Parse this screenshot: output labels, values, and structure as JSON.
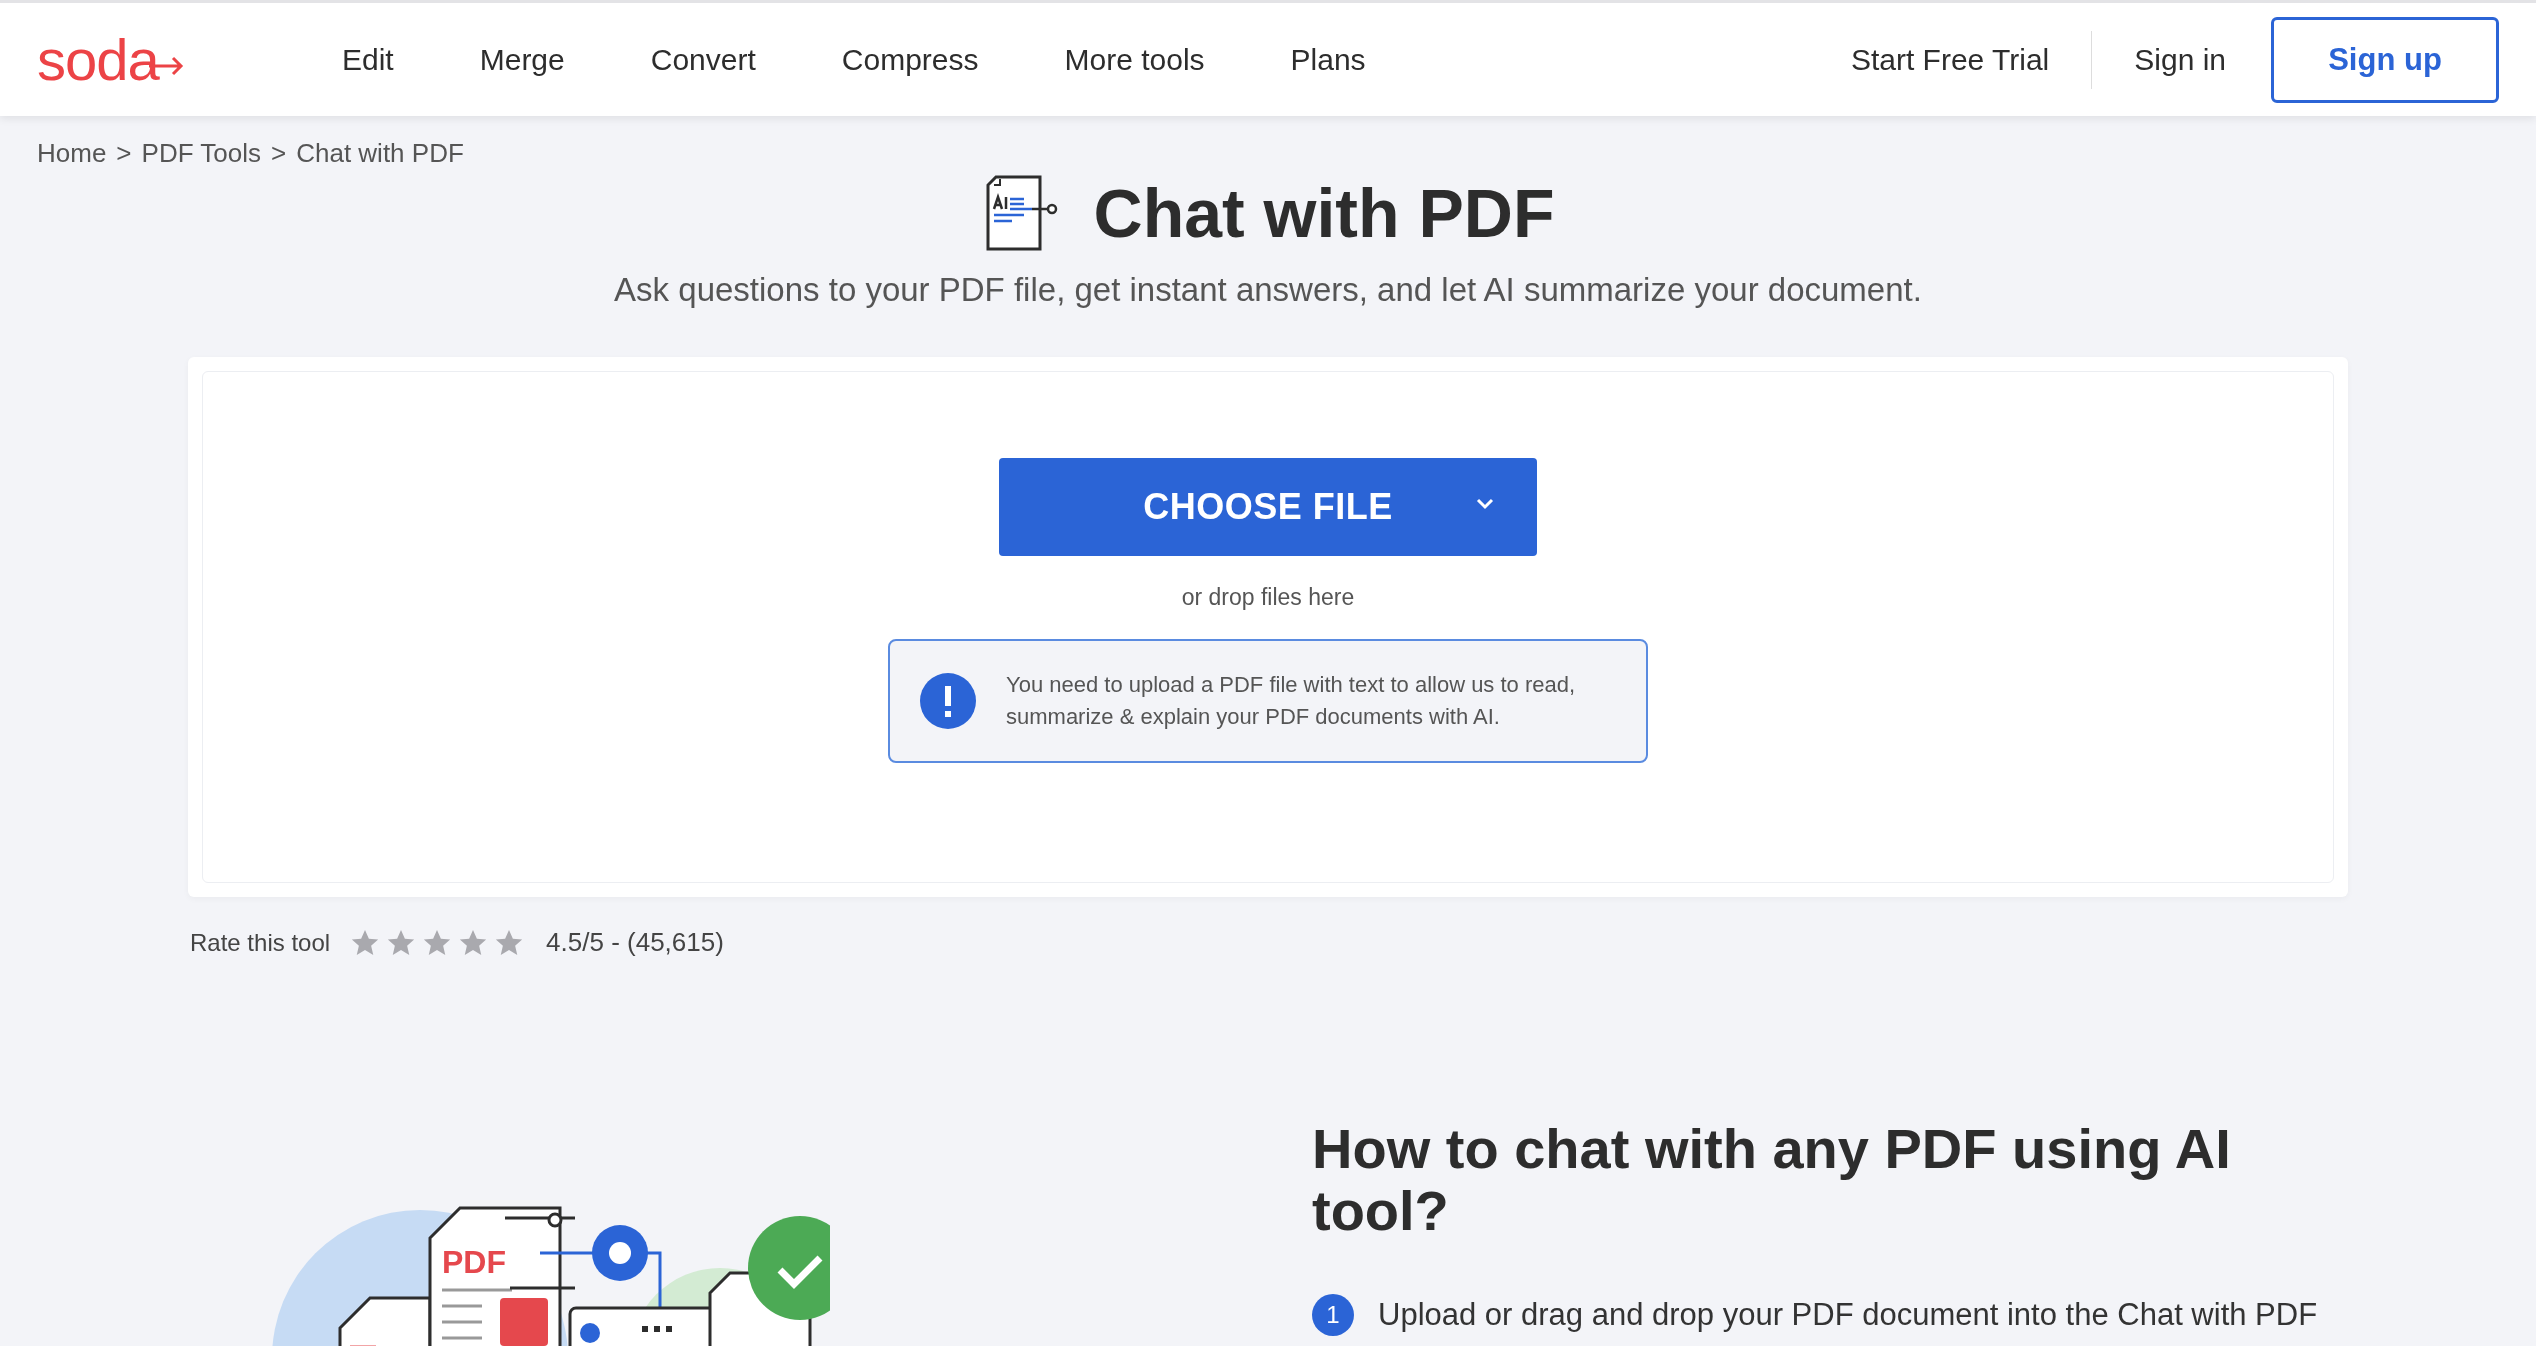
{
  "header": {
    "logo": "soda",
    "nav": [
      "Edit",
      "Merge",
      "Convert",
      "Compress",
      "More tools",
      "Plans"
    ],
    "start_trial": "Start Free Trial",
    "sign_in": "Sign in",
    "sign_up": "Sign up"
  },
  "breadcrumb": [
    "Home",
    "PDF Tools",
    "Chat with PDF"
  ],
  "breadcrumb_separator": ">",
  "title": "Chat with PDF",
  "subtitle": "Ask questions to your PDF file, get instant answers, and let AI summarize your document.",
  "upload": {
    "button": "CHOOSE FILE",
    "hint": "or drop files here",
    "notice": "You need to upload a PDF file with text to allow us to read, summarize & explain your PDF documents with AI."
  },
  "rating": {
    "label": "Rate this tool",
    "stars": 0,
    "score": "4.5/5 - (45,615)"
  },
  "howto": {
    "illustration_label": "PDF",
    "heading": "How to chat with any PDF using AI tool?",
    "steps": [
      {
        "number": "1",
        "text": "Upload or drag and drop your PDF document into the Chat with PDF"
      }
    ]
  }
}
